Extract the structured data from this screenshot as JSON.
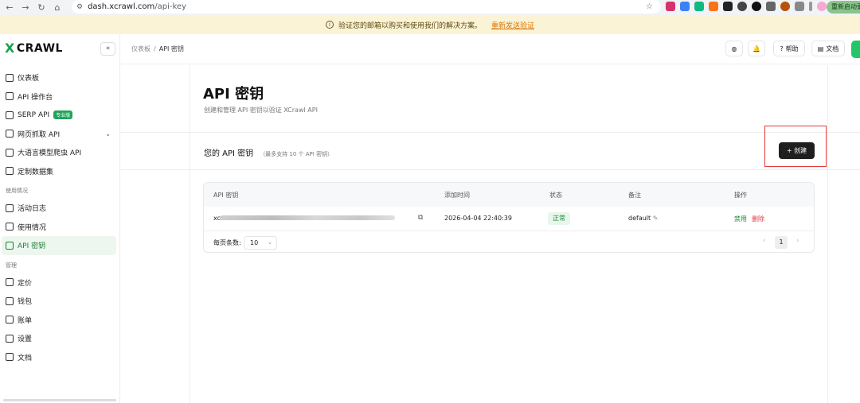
{
  "browser": {
    "url_domain": "dash.xcrawl.com",
    "url_path": "/api-key",
    "restart_label": "重新启动更新"
  },
  "notice": {
    "text": "验证您的邮箱以购买和使用我们的解决方案。",
    "link": "重新发送验证"
  },
  "brand": {
    "logo_text": "CRAWL",
    "logo_mark": "X"
  },
  "sidebar": {
    "items": [
      {
        "label": "仪表板",
        "icon": "grid-icon"
      },
      {
        "label": "API 操作台",
        "icon": "console-icon"
      },
      {
        "label": "SERP API",
        "icon": "serp-icon",
        "badge": "专业版"
      },
      {
        "label": "网页抓取 API",
        "icon": "scrape-icon",
        "expandable": true
      },
      {
        "label": "大语言模型爬虫 API",
        "icon": "llm-icon"
      },
      {
        "label": "定制数据集",
        "icon": "dataset-icon"
      }
    ],
    "section_usage": "使用情况",
    "usage_items": [
      {
        "label": "活动日志",
        "icon": "log-icon"
      },
      {
        "label": "使用情况",
        "icon": "usage-icon"
      },
      {
        "label": "API 密钥",
        "icon": "key-icon",
        "active": true
      }
    ],
    "section_manage": "管理",
    "manage_items": [
      {
        "label": "定价",
        "icon": "price-icon"
      },
      {
        "label": "钱包",
        "icon": "wallet-icon"
      },
      {
        "label": "账单",
        "icon": "bill-icon"
      },
      {
        "label": "设置",
        "icon": "settings-icon"
      },
      {
        "label": "文档",
        "icon": "doc-icon"
      }
    ]
  },
  "topbar": {
    "breadcrumb_root": "仪表板",
    "breadcrumb_current": "API 密钥",
    "help_label": "帮助",
    "docs_label": "文档"
  },
  "page": {
    "title": "API 密钥",
    "subtitle": "创建和管理 API 密钥以验证 XCrawl API",
    "section_title": "您的 API 密钥",
    "section_note": "（最多支持 10 个 API 密钥）",
    "create_label": "+ 创建"
  },
  "table": {
    "headers": [
      "API 密钥",
      "添加时间",
      "状态",
      "备注",
      "操作"
    ],
    "rows": [
      {
        "key_prefix": "xc",
        "added": "2026-04-04 22:40:39",
        "status": "正常",
        "note": "default",
        "action_disable": "禁用",
        "action_delete": "删除"
      }
    ],
    "page_size_label": "每页条数:",
    "page_size": "10",
    "current_page": "1"
  },
  "colors": {
    "accent": "#22a35a",
    "danger": "#e0394b",
    "highlight": "#e23b3b"
  }
}
